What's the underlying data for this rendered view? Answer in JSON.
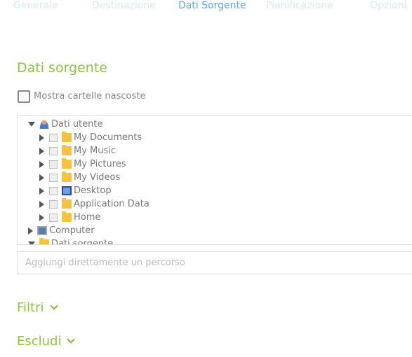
{
  "tabs": [
    {
      "label": "Generale"
    },
    {
      "label": "Destinazione"
    },
    {
      "label": "Dati Sorgente",
      "active": true
    },
    {
      "label": "Pianificazione"
    },
    {
      "label": "Opzioni"
    }
  ],
  "section_title": "Dati sorgente",
  "show_hidden": {
    "label": "Mostra cartelle nascoste",
    "checked": false
  },
  "tree": [
    {
      "label": "Dati utente",
      "icon": "user-icon",
      "expanded": true
    },
    {
      "label": "My Documents",
      "icon": "documents-folder-icon"
    },
    {
      "label": "My Music",
      "icon": "music-folder-icon"
    },
    {
      "label": "My Pictures",
      "icon": "pictures-folder-icon"
    },
    {
      "label": "My Videos",
      "icon": "folder-icon"
    },
    {
      "label": "Desktop",
      "icon": "desktop-icon"
    },
    {
      "label": "Application Data",
      "icon": "folder-icon"
    },
    {
      "label": "Home",
      "icon": "home-folder-icon"
    },
    {
      "label": "Computer",
      "icon": "computer-icon"
    },
    {
      "label": "Dati sorgente",
      "icon": "folder-icon",
      "expanded": true
    }
  ],
  "path_input": {
    "placeholder": "Aggiungi direttamente un percorso",
    "value": ""
  },
  "filters_label": "Filtri",
  "exclude_label": "Escludi",
  "colors": {
    "accent_green": "#8cc63f",
    "active_tab": "#5aa9e0",
    "inactive_tab": "#d4e9f7"
  }
}
